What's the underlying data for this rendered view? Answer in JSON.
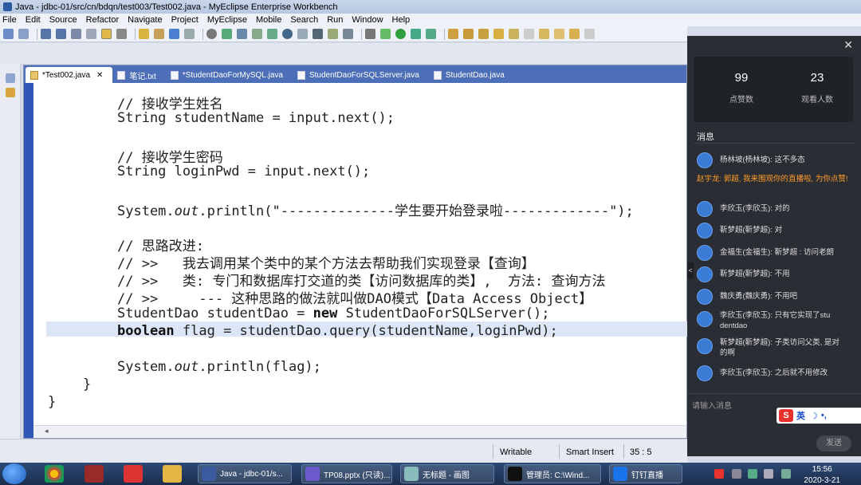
{
  "window": {
    "title": "Java - jdbc-01/src/cn/bdqn/test003/Test002.java - MyEclipse Enterprise Workbench"
  },
  "menu": [
    "File",
    "Edit",
    "Source",
    "Refactor",
    "Navigate",
    "Project",
    "MyEclipse",
    "Mobile",
    "Search",
    "Run",
    "Window",
    "Help"
  ],
  "tabs": [
    {
      "label": "*Test002.java",
      "close": "✕"
    },
    {
      "label": "笔记.txt"
    },
    {
      "label": "*StudentDaoForMySQL.java"
    },
    {
      "label": "StudentDaoForSQLServer.java"
    },
    {
      "label": "StudentDao.java"
    }
  ],
  "code": {
    "l1": "// 接收学生姓名",
    "l2": "String studentName = input.next();",
    "l3": "// 接收学生密码",
    "l4": "String loginPwd = input.next();",
    "l5_pre": "System.",
    "l5_out": "out",
    "l5_post": ".println(\"--------------学生要开始登录啦-------------\");",
    "l6": "// 思路改进:",
    "l7": "// >>   我去调用某个类中的某个方法去帮助我们实现登录【查询】",
    "l8": "// >>   类: 专门和数据库打交道的类【访问数据库的类】,  方法: 查询方法",
    "l9": "// >>     --- 这种思路的做法就叫做DAO模式【Data Access Object】",
    "l10_pre": "StudentDao studentDao = ",
    "l10_kw": "new",
    "l10_post": " StudentDaoForSQLServer();",
    "l11_kw": "boolean",
    "l11_post": " flag = studentDao.query(studentName,loginPwd);",
    "l12_pre": "System.",
    "l12_out": "out",
    "l12_post": ".println(flag);",
    "brace1": "}",
    "brace2": "}"
  },
  "status": {
    "writable": "Writable",
    "insert": "Smart Insert",
    "position": "35 : 5"
  },
  "live": {
    "close": "✕",
    "likes": "99",
    "likes_label": "点赞数",
    "viewers": "23",
    "viewers_label": "观看人数",
    "messages_title": "消息",
    "messages": [
      "杨林坡(杨林坡): 这不多态",
      "李欣玉(李欣玉): 对的",
      "靳梦超(靳梦超): 对",
      "金福生(金福生): 靳梦超 : 访问老朗",
      "靳梦超(靳梦超): 不用",
      "魏庆勇(魏庆勇): 不用吧",
      "李欣玉(李欣玉): 只有它实现了studentdao",
      "靳梦超(靳梦超): 子类访问父类, 是对的啊",
      "李欣玉(李欣玉): 之后就不用修改"
    ],
    "system_message": "赵宇龙: 郭超, 我来围观你的直播啦, 为你点赞!",
    "input_placeholder": "请输入消息",
    "send": "发送",
    "collapse": "<",
    "ime": "英"
  },
  "taskbar": {
    "items": [
      "Java - jdbc-01/s...",
      "TP08.pptx (只读)...",
      "无标题 - 画图",
      "管理员: C:\\Wind...",
      "钉钉直播"
    ],
    "time": "15:56",
    "date": "2020-3-21"
  }
}
